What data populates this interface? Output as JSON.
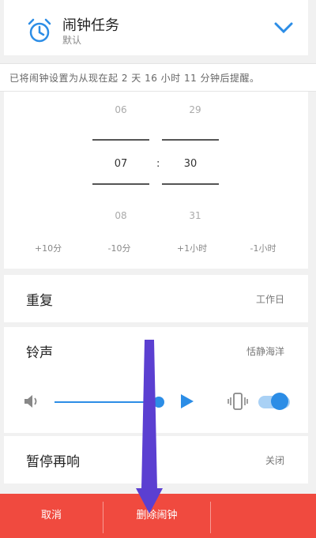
{
  "header": {
    "title": "闹钟任务",
    "subtitle": "默认",
    "icon": "alarm-clock-icon"
  },
  "notice": "已将闹钟设置为从现在起 2 天 16 小时 11 分钟后提醒。",
  "picker": {
    "hour_prev": "06",
    "hour_current": "07",
    "hour_next": "08",
    "minute_prev": "29",
    "minute_current": "30",
    "minute_next": "31",
    "separator": ":",
    "adjust": [
      "+10分",
      "-10分",
      "+1小时",
      "-1小时"
    ]
  },
  "repeat": {
    "label": "重复",
    "value": "工作日"
  },
  "ringtone": {
    "label": "铃声",
    "value": "恬静海洋"
  },
  "sound": {
    "volume_level": 0.95,
    "vibrate_on": true,
    "accent": "#2c8de6"
  },
  "snooze": {
    "label": "暂停再响",
    "value": "关闭"
  },
  "bottom_bar": {
    "cancel": "取消",
    "delete": "删除闹钟",
    "color": "#f04a3f"
  },
  "overlay": {
    "arrow_color": "#5b3fd1"
  }
}
